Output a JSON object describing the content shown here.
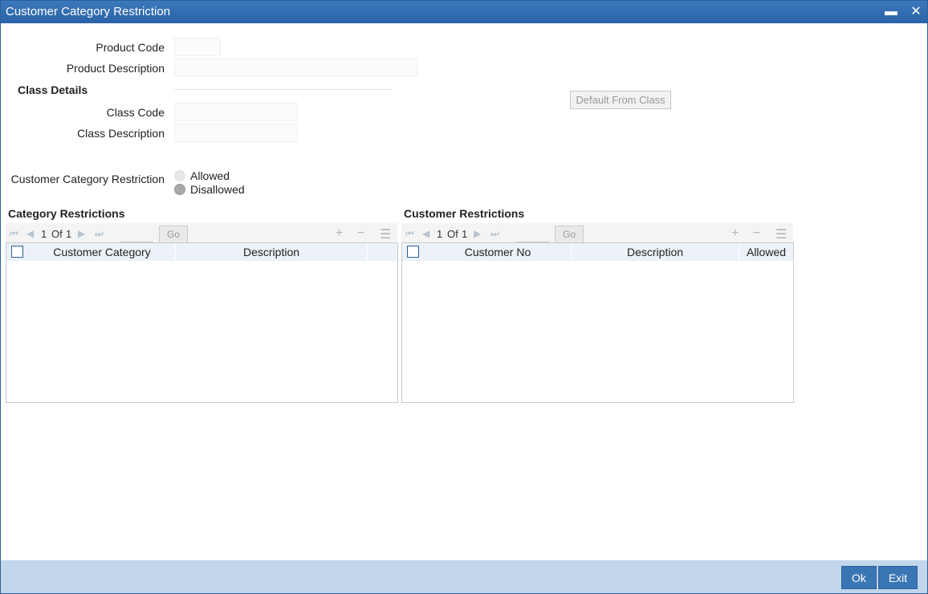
{
  "window": {
    "title": "Customer Category Restriction"
  },
  "form": {
    "product_code_label": "Product Code",
    "product_description_label": "Product Description",
    "class_details_title": "Class Details",
    "class_code_label": "Class Code",
    "class_description_label": "Class Description",
    "default_from_class_button": "Default From Class",
    "restriction_label": "Customer Category Restriction",
    "allowed_label": "Allowed",
    "disallowed_label": "Disallowed",
    "selected_restriction": "Disallowed"
  },
  "category_grid": {
    "title": "Category Restrictions",
    "page_current": "1",
    "page_of": "Of",
    "page_total": "1",
    "go_label": "Go",
    "columns": [
      "Customer Category",
      "Description"
    ]
  },
  "customer_grid": {
    "title": "Customer Restrictions",
    "page_current": "1",
    "page_of": "Of",
    "page_total": "1",
    "go_label": "Go",
    "columns": [
      "Customer No",
      "Description",
      "Allowed"
    ]
  },
  "footer": {
    "ok_label": "Ok",
    "exit_label": "Exit"
  },
  "colors": {
    "titlebar": "#2a63a6",
    "footer": "#c2d6eb",
    "button": "#3a76b4"
  }
}
